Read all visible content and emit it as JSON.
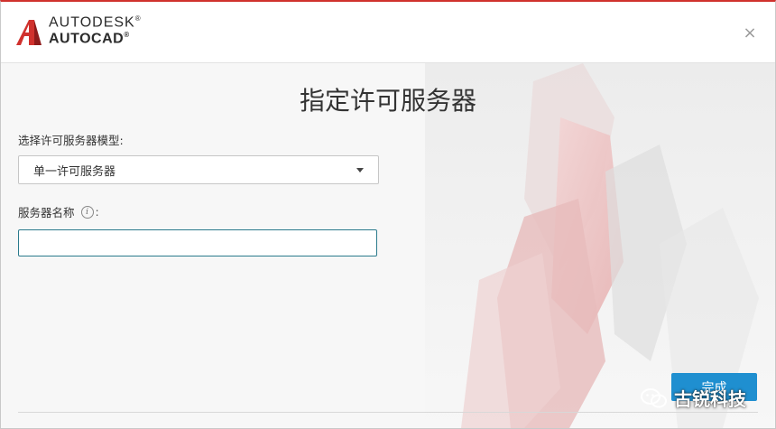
{
  "brand": {
    "line1": "AUTODESK",
    "line2": "AUTOCAD",
    "trademark": "®",
    "accent": "#d0312d"
  },
  "close": {
    "icon": "close-icon",
    "glyph": "×"
  },
  "page": {
    "title": "指定许可服务器"
  },
  "form": {
    "model_label": "选择许可服务器模型:",
    "model_value": "单一许可服务器",
    "name_label": "服务器名称",
    "name_colon": ":",
    "name_value": "",
    "info_glyph": "i"
  },
  "actions": {
    "done_label": "完成",
    "done_color": "#1f8fd0"
  },
  "watermark": {
    "text": "古锐科技"
  }
}
